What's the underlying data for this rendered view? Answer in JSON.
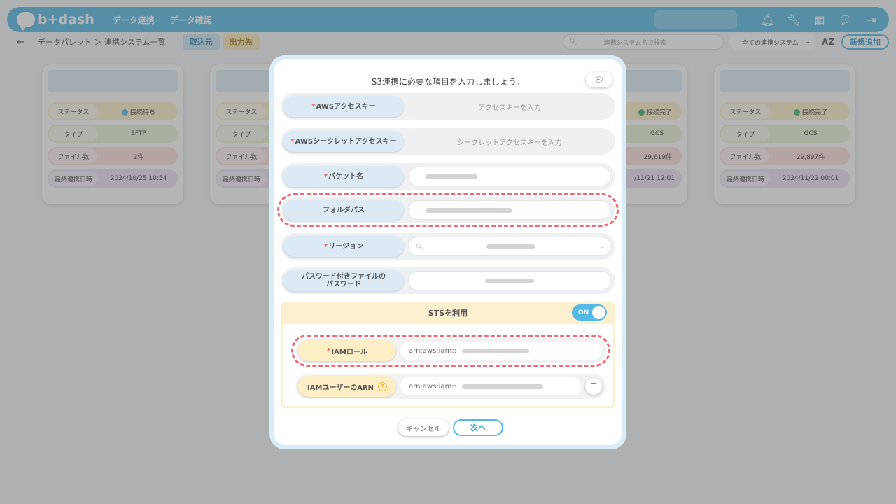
{
  "brand": "b+dash",
  "nav": {
    "item1": "データ連携",
    "item2": "データ確認"
  },
  "breadcrumb": {
    "back": "←",
    "path": "データパレット ＞ 連携システム一覧"
  },
  "tabs": {
    "in": "取込元",
    "out": "出力先"
  },
  "search": {
    "placeholder": "連携システム名で検索"
  },
  "filter": {
    "value": "全ての連携システム"
  },
  "sort_label": "AZ",
  "new_button": "新規追加",
  "cards": [
    {
      "status_label": "ステータス",
      "status": "接続待ち",
      "type_label": "タイプ",
      "type": "SFTP",
      "files_label": "ファイル数",
      "files": "2件",
      "date_label": "最終連携日時",
      "date": "2024/10/25 10:54"
    },
    {
      "status_label": "ステータス",
      "type_label": "タイプ",
      "files_label": "ファイル数",
      "date_label": "最終連携日時"
    },
    {
      "status": "接続完了",
      "type": "GCS",
      "files": "29,619件",
      "date": "/11/21 12:01"
    },
    {
      "status_label": "ステータス",
      "status": "接続完了",
      "type_label": "タイプ",
      "type": "GCS",
      "files_label": "ファイル数",
      "files": "29,897件",
      "date_label": "最終連携日時",
      "date": "2024/11/22 00:01"
    }
  ],
  "modal": {
    "title": "S3連携に必要な項目を入力しましょう。",
    "req_mark": "*",
    "access_key": {
      "label": "AWSアクセスキー",
      "placeholder": "アクセスキーを入力"
    },
    "secret_key": {
      "label": "AWSシークレットアクセスキー",
      "placeholder": "シークレットアクセスキーを入力"
    },
    "bucket": {
      "label": "バケット名"
    },
    "folder": {
      "label": "フォルダパス"
    },
    "region": {
      "label": "リージョン"
    },
    "zip_password": {
      "label": "パスワード付きファイルの",
      "label2": "パスワード"
    },
    "sts": {
      "label": "STSを利用",
      "toggle": "ON"
    },
    "iam_role": {
      "label": "IAMロール",
      "prefix": "arn:aws:iam::"
    },
    "iam_user_arn": {
      "label": "IAMユーザーのARN",
      "prefix": "arn:aws:iam::"
    },
    "cancel": "キャンセル",
    "next": "次へ"
  }
}
